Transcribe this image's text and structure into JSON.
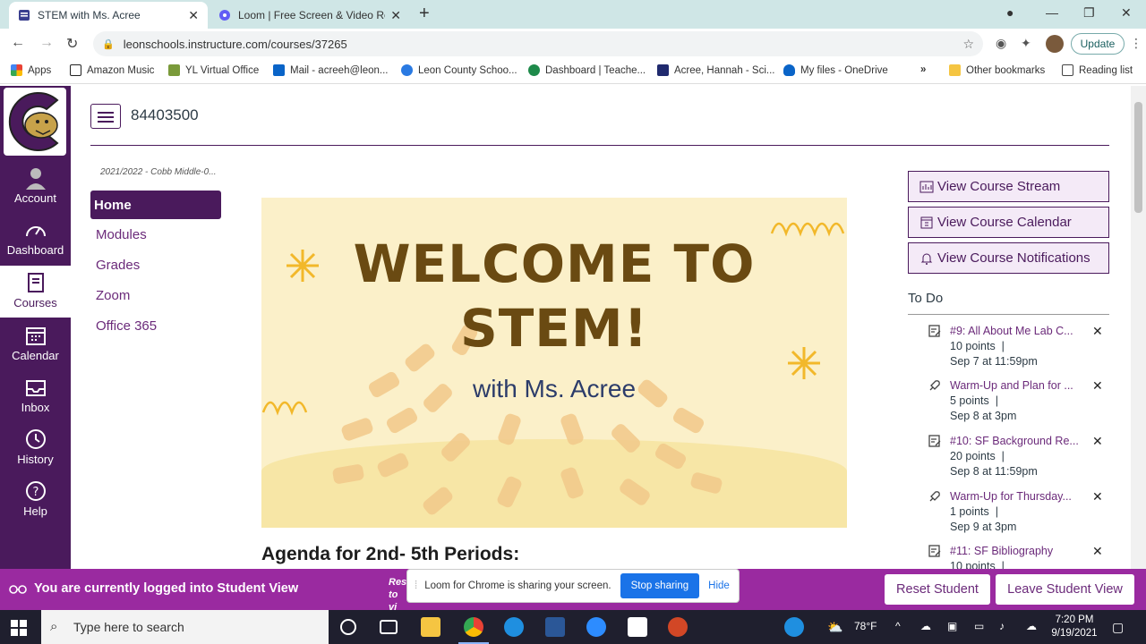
{
  "browser": {
    "tabs": [
      {
        "title": "STEM with Ms. Acree",
        "icon": "canvas-icon"
      },
      {
        "title": "Loom | Free Screen & Video Rec",
        "icon": "loom-icon"
      }
    ],
    "url": "leonschools.instructure.com/courses/37265",
    "update_label": "Update",
    "bookmarks": [
      {
        "label": "Apps",
        "color": "#e94235"
      },
      {
        "label": "Amazon Music",
        "color": "#222222"
      },
      {
        "label": "YL Virtual Office",
        "color": "#7a9a3a"
      },
      {
        "label": "Mail - acreeh@leon...",
        "color": "#0a64c8"
      },
      {
        "label": "Leon County Schoo...",
        "color": "#2a7ae2"
      },
      {
        "label": "Dashboard | Teache...",
        "color": "#1e8a4a"
      },
      {
        "label": "Acree, Hannah - Sci...",
        "color": "#202a6e"
      },
      {
        "label": "My files - OneDrive",
        "color": "#0a64c8"
      }
    ],
    "more_bookmarks": "»",
    "other_bookmarks": "Other bookmarks",
    "reading_list": "Reading list"
  },
  "global_nav": [
    {
      "label": "Account",
      "icon": "account-icon"
    },
    {
      "label": "Dashboard",
      "icon": "dashboard-icon"
    },
    {
      "label": "Courses",
      "icon": "courses-icon",
      "active": true
    },
    {
      "label": "Calendar",
      "icon": "calendar-icon"
    },
    {
      "label": "Inbox",
      "icon": "inbox-icon"
    },
    {
      "label": "History",
      "icon": "history-icon"
    },
    {
      "label": "Help",
      "icon": "help-icon"
    }
  ],
  "header": {
    "course_id": "84403500"
  },
  "course_nav": {
    "term": "2021/2022 - Cobb Middle-0...",
    "items": [
      "Home",
      "Modules",
      "Grades",
      "Zoom",
      "Office 365"
    ]
  },
  "banner": {
    "line1": "WELCOME TO",
    "line2": "STEM!",
    "sub": "with Ms. Acree"
  },
  "agenda_heading": "Agenda for 2nd- 5th Periods:",
  "right_buttons": [
    {
      "label": "View Course Stream",
      "icon": "stream-icon"
    },
    {
      "label": "View Course Calendar",
      "icon": "calendar-icon"
    },
    {
      "label": "View Course Notifications",
      "icon": "bell-icon"
    }
  ],
  "todo": {
    "heading": "To Do",
    "items": [
      {
        "title": "#9: All About Me Lab C...",
        "points": "10 points",
        "due": "Sep 7 at 11:59pm",
        "icon": "assignment-icon"
      },
      {
        "title": "Warm-Up and Plan for ...",
        "points": "5 points",
        "due": "Sep 8 at 3pm",
        "icon": "quiz-rocket-icon"
      },
      {
        "title": "#10: SF Background Re...",
        "points": "20 points",
        "due": "Sep 8 at 11:59pm",
        "icon": "assignment-icon"
      },
      {
        "title": "Warm-Up for Thursday...",
        "points": "1 points",
        "due": "Sep 9 at 3pm",
        "icon": "quiz-rocket-icon"
      },
      {
        "title": "#11: SF Bibliography",
        "points": "10 points",
        "due": "",
        "icon": "assignment-icon"
      }
    ]
  },
  "student_view": {
    "message": "You are currently logged into Student View",
    "reset_label": "Reset Student",
    "leave_label": "Leave Student View",
    "partial_text": "Res to vi"
  },
  "loom": {
    "message": "Loom for Chrome is sharing your screen.",
    "stop_label": "Stop sharing",
    "hide_label": "Hide"
  },
  "taskbar": {
    "search_placeholder": "Type here to search",
    "temperature": "78°F",
    "time": "7:20 PM",
    "date": "9/19/2021"
  }
}
